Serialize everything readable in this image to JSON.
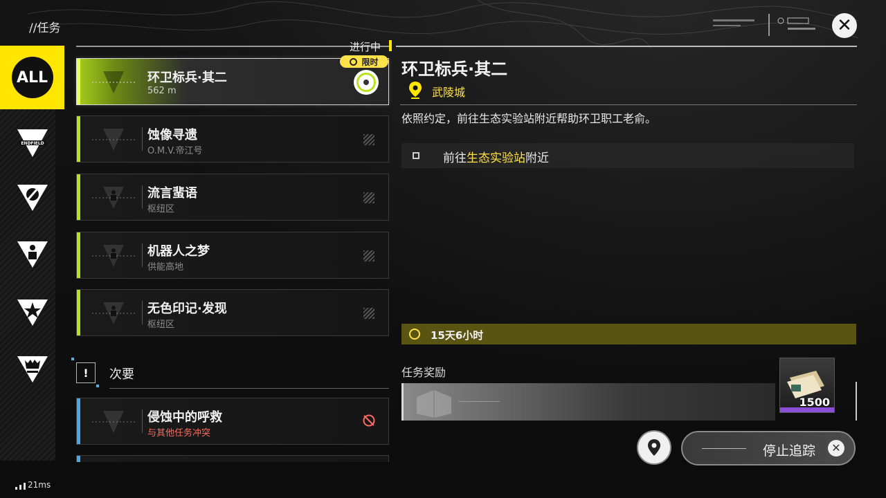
{
  "header": {
    "breadcrumb": "//任务",
    "close_icon": "close-icon"
  },
  "categories": [
    {
      "name": "all",
      "label": "ALL",
      "active": true
    },
    {
      "name": "endfield",
      "label": "ENDFIELD"
    },
    {
      "name": "feather",
      "icon": "feather-icon"
    },
    {
      "name": "person",
      "icon": "person-icon"
    },
    {
      "name": "star",
      "icon": "star-icon"
    },
    {
      "name": "crown",
      "icon": "crown-icon"
    }
  ],
  "list": {
    "in_progress_label": "进行中",
    "limited_label": "限时",
    "quests": [
      {
        "title": "环卫标兵·其二",
        "sub": "562 m",
        "active": true
      },
      {
        "title": "蚀像寻遗",
        "sub": "O.M.V.帝江号"
      },
      {
        "title": "流言蜚语",
        "sub": "枢纽区"
      },
      {
        "title": "机器人之梦",
        "sub": "供能高地"
      },
      {
        "title": "无色印记·发现",
        "sub": "枢纽区"
      }
    ],
    "secondary": {
      "label": "次要",
      "quests": [
        {
          "title": "侵蚀中的呼救",
          "sub": "与其他任务冲突"
        }
      ]
    }
  },
  "detail": {
    "title": "环卫标兵·其二",
    "location": "武陵城",
    "description": "依照约定，前往生态实验站附近帮助环卫职工老俞。",
    "objective": {
      "prefix": "前往",
      "highlight": "生态实验站",
      "suffix": "附近"
    },
    "timer": "15天6小时",
    "rewards_label": "任务奖励",
    "reward_qty": "1500"
  },
  "actions": {
    "stop_label": "停止追踪"
  },
  "status": {
    "ping": "21ms"
  },
  "colors": {
    "accent": "#ffe600",
    "active_green": "#b6e21e",
    "conflict_red": "#ff6b5e",
    "secondary_blue": "#4aa8e8"
  }
}
